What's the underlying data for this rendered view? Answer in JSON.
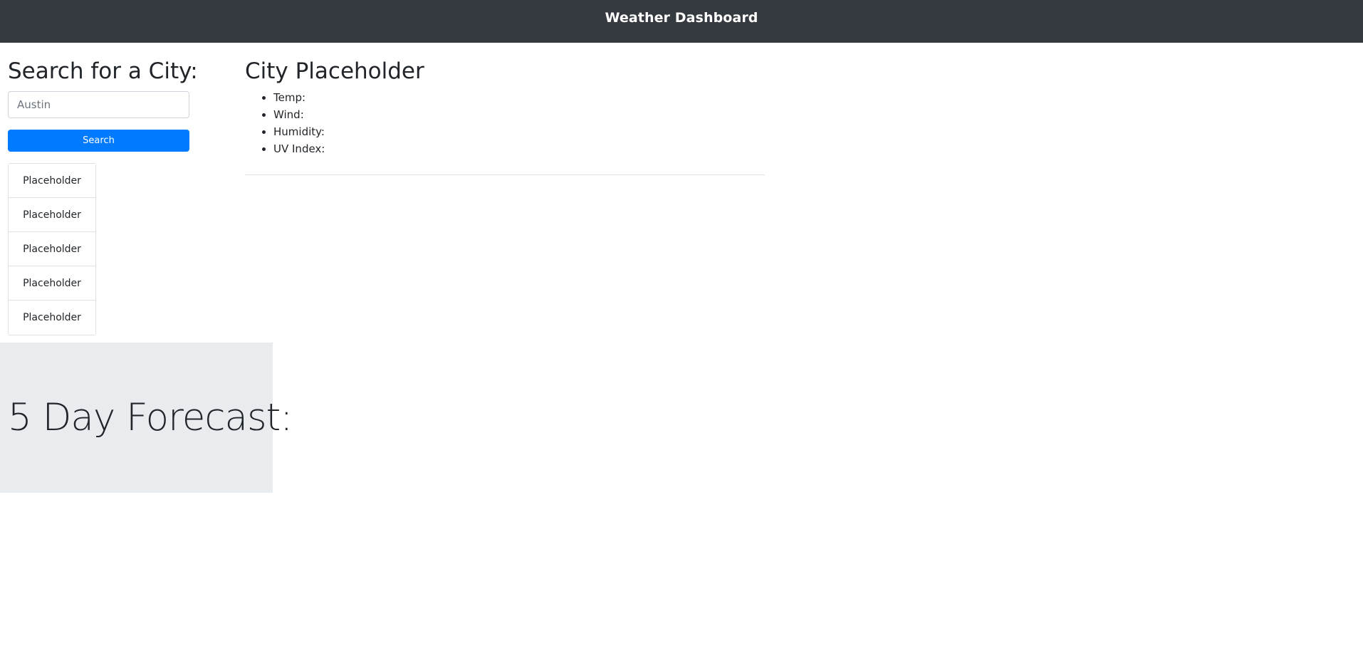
{
  "header": {
    "title": "Weather Dashboard"
  },
  "sidebar": {
    "heading": "Search for a City:",
    "search": {
      "placeholder": "Austin",
      "value": ""
    },
    "search_button_label": "Search",
    "history": [
      {
        "label": "Placeholder"
      },
      {
        "label": "Placeholder"
      },
      {
        "label": "Placeholder"
      },
      {
        "label": "Placeholder"
      },
      {
        "label": "Placeholder"
      }
    ]
  },
  "current_weather": {
    "city": "City Placeholder",
    "details": [
      {
        "label": "Temp:"
      },
      {
        "label": "Wind:"
      },
      {
        "label": "Humidity:"
      },
      {
        "label": "UV Index:"
      }
    ]
  },
  "forecast": {
    "title": "5 Day Forecast:"
  },
  "colors": {
    "navbar": "#343a40",
    "primary": "#007bff",
    "forecast_bg": "#e9ecef"
  }
}
